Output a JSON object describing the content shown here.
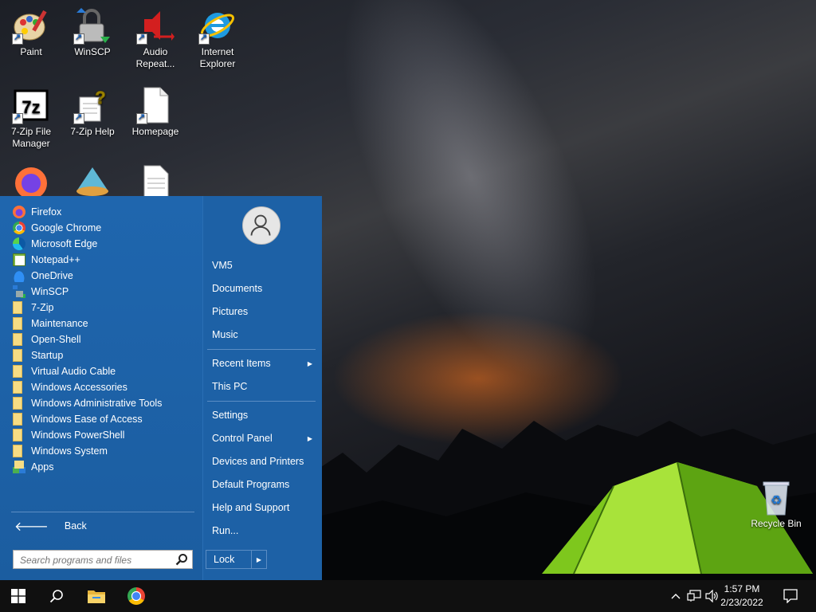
{
  "desktop": {
    "icons": [
      {
        "label": "Paint",
        "icon": "paint-icon"
      },
      {
        "label": "WinSCP",
        "icon": "winscp-icon"
      },
      {
        "label": "Audio Repeat...",
        "icon": "audio-repeater-icon"
      },
      {
        "label": "Internet Explorer",
        "icon": "internet-explorer-icon"
      },
      {
        "label": "7-Zip File Manager",
        "icon": "7zip-icon"
      },
      {
        "label": "7-Zip Help",
        "icon": "help-file-icon"
      },
      {
        "label": "Homepage",
        "icon": "document-icon"
      },
      {
        "label": "Recycle Bin",
        "icon": "recycle-bin-icon"
      }
    ]
  },
  "start_menu": {
    "programs": [
      {
        "label": "Firefox",
        "icon": "firefox-icon"
      },
      {
        "label": "Google Chrome",
        "icon": "chrome-icon"
      },
      {
        "label": "Microsoft Edge",
        "icon": "edge-icon"
      },
      {
        "label": "Notepad++",
        "icon": "notepadpp-icon"
      },
      {
        "label": "OneDrive",
        "icon": "onedrive-icon"
      },
      {
        "label": "WinSCP",
        "icon": "winscp-icon"
      },
      {
        "label": "7-Zip",
        "icon": "folder-icon"
      },
      {
        "label": "Maintenance",
        "icon": "folder-icon"
      },
      {
        "label": "Open-Shell",
        "icon": "folder-icon"
      },
      {
        "label": "Startup",
        "icon": "folder-icon"
      },
      {
        "label": "Virtual Audio Cable",
        "icon": "folder-icon"
      },
      {
        "label": "Windows Accessories",
        "icon": "folder-icon"
      },
      {
        "label": "Windows Administrative Tools",
        "icon": "folder-icon"
      },
      {
        "label": "Windows Ease of Access",
        "icon": "folder-icon"
      },
      {
        "label": "Windows PowerShell",
        "icon": "folder-icon"
      },
      {
        "label": "Windows System",
        "icon": "folder-icon"
      },
      {
        "label": "Apps",
        "icon": "apps-icon"
      }
    ],
    "back_label": "Back",
    "search_placeholder": "Search programs and files",
    "right_items": [
      {
        "label": "VM5"
      },
      {
        "label": "Documents"
      },
      {
        "label": "Pictures"
      },
      {
        "label": "Music"
      },
      {
        "label": "Recent Items",
        "submenu": true
      },
      {
        "label": "This PC"
      },
      {
        "label": "Settings"
      },
      {
        "label": "Control Panel",
        "submenu": true
      },
      {
        "label": "Devices and Printers"
      },
      {
        "label": "Default Programs"
      },
      {
        "label": "Help and Support"
      },
      {
        "label": "Run..."
      }
    ],
    "lock_label": "Lock"
  },
  "taskbar": {
    "time": "1:57 PM",
    "date": "2/23/2022"
  },
  "colors": {
    "start_bg": "#1d61a6",
    "taskbar_bg": "#101010",
    "folder": "#f6dc84"
  }
}
